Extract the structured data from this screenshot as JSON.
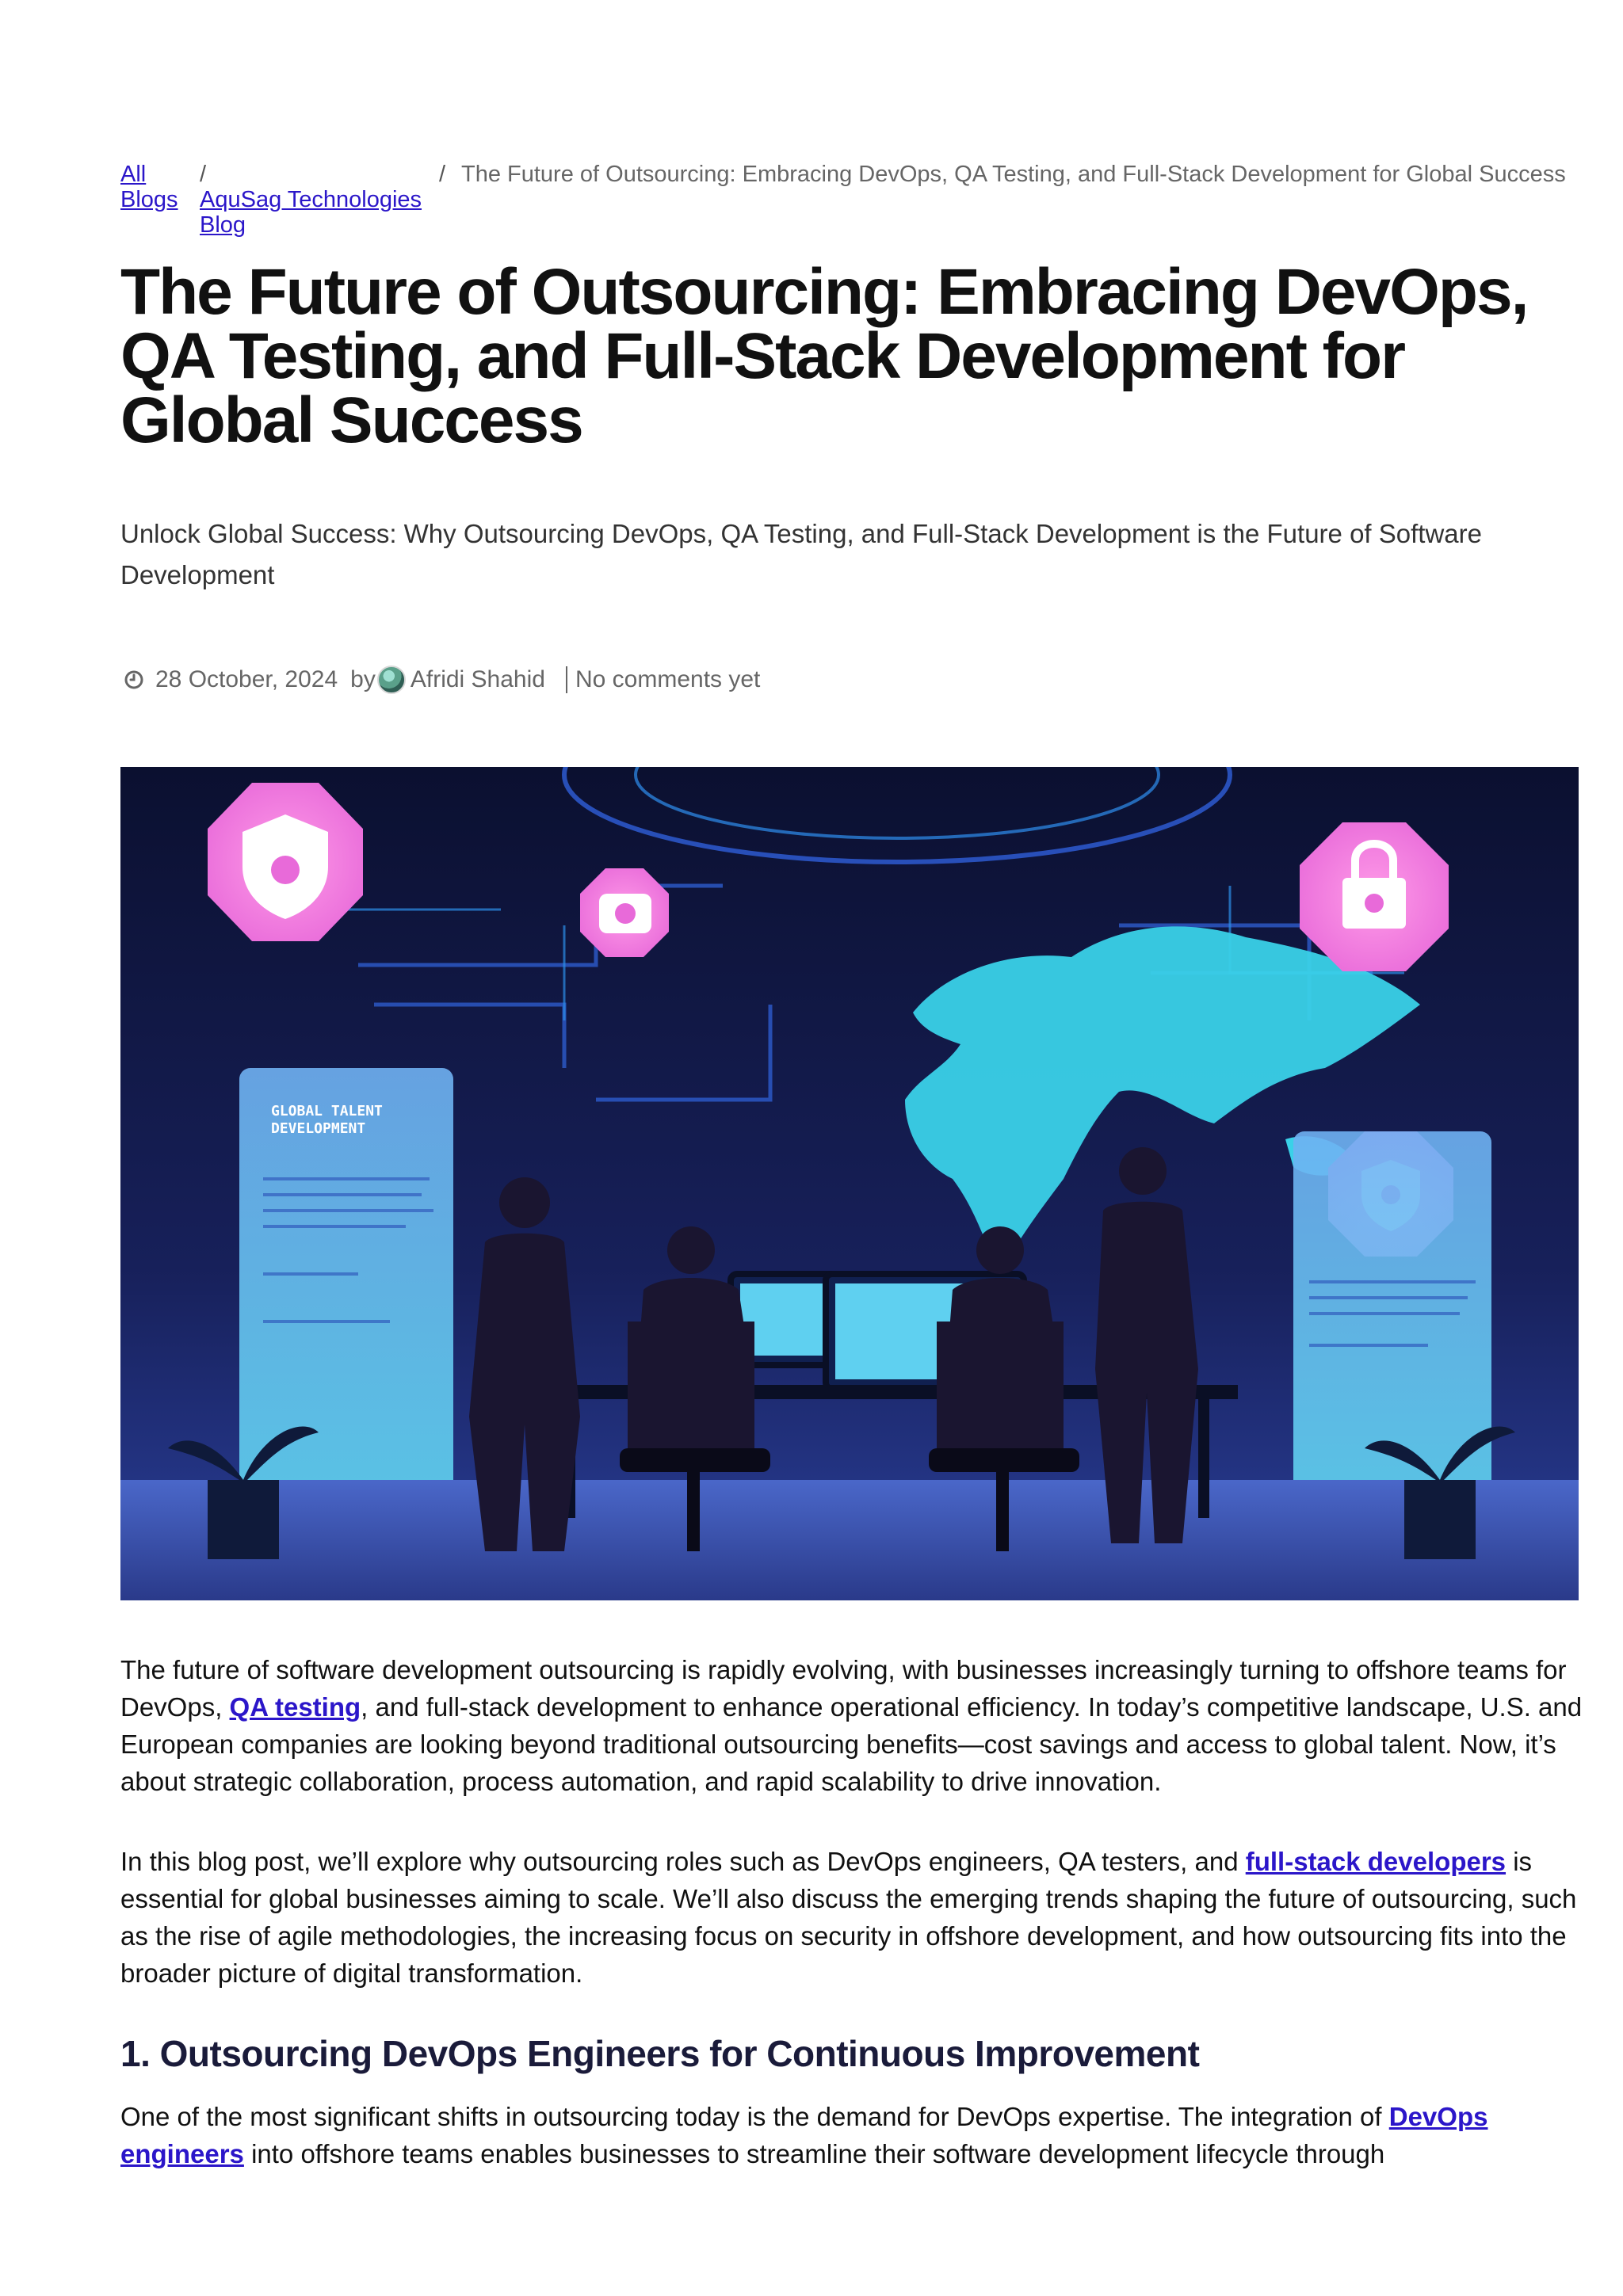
{
  "breadcrumb": {
    "all_blogs": "All Blogs",
    "separator": "/",
    "blog": "AquSag Technologies Blog",
    "current": "The Future of Outsourcing: Embracing DevOps, QA Testing, and Full-Stack Development for Global Success"
  },
  "article": {
    "title": "The Future of Outsourcing: Embracing DevOps, QA Testing, and Full-Stack Development for Global Success",
    "subtitle": "Unlock Global Success: Why Outsourcing DevOps, QA Testing, and Full-Stack Development is the Future of Software Development",
    "meta": {
      "clock_icon": "clock-icon",
      "date": "28 October, 2024",
      "by": "by",
      "author": "Afridi Shahid",
      "comments": "No comments yet"
    },
    "hero_image": {
      "type": "illustration",
      "panel_text_1": "GLOBAL TALENT",
      "panel_text_2": "DEVELOPMENT"
    },
    "p1": {
      "t1": "The future of software development outsourcing is rapidly evolving, with businesses increasingly turning to offshore teams for DevOps, ",
      "link": "QA testing",
      "t2": ", and full-stack development to enhance operational efficiency. In today’s competitive landscape, U.S. and European companies are looking beyond traditional outsourcing benefits—cost savings and access to global talent. Now, it’s about strategic collaboration, process automation, and rapid scalability to drive innovation."
    },
    "p2": {
      "t1": "In this blog post, we’ll explore why outsourcing roles such as DevOps engineers, QA testers, and ",
      "link": "full-stack developers",
      "t2": " is essential for global businesses aiming to scale. We’ll also discuss the emerging trends shaping the future of outsourcing, such as the rise of agile methodologies, the increasing focus on security in offshore development, and how outsourcing fits into the broader picture of digital transformation."
    },
    "section1": {
      "heading": "1. Outsourcing DevOps Engineers for Continuous Improvement",
      "t1": "One of the most significant shifts in outsourcing today is the demand for DevOps expertise. The integration of ",
      "link": "DevOps engineers",
      "t2": " into offshore teams enables businesses to streamline their software development lifecycle through"
    }
  }
}
